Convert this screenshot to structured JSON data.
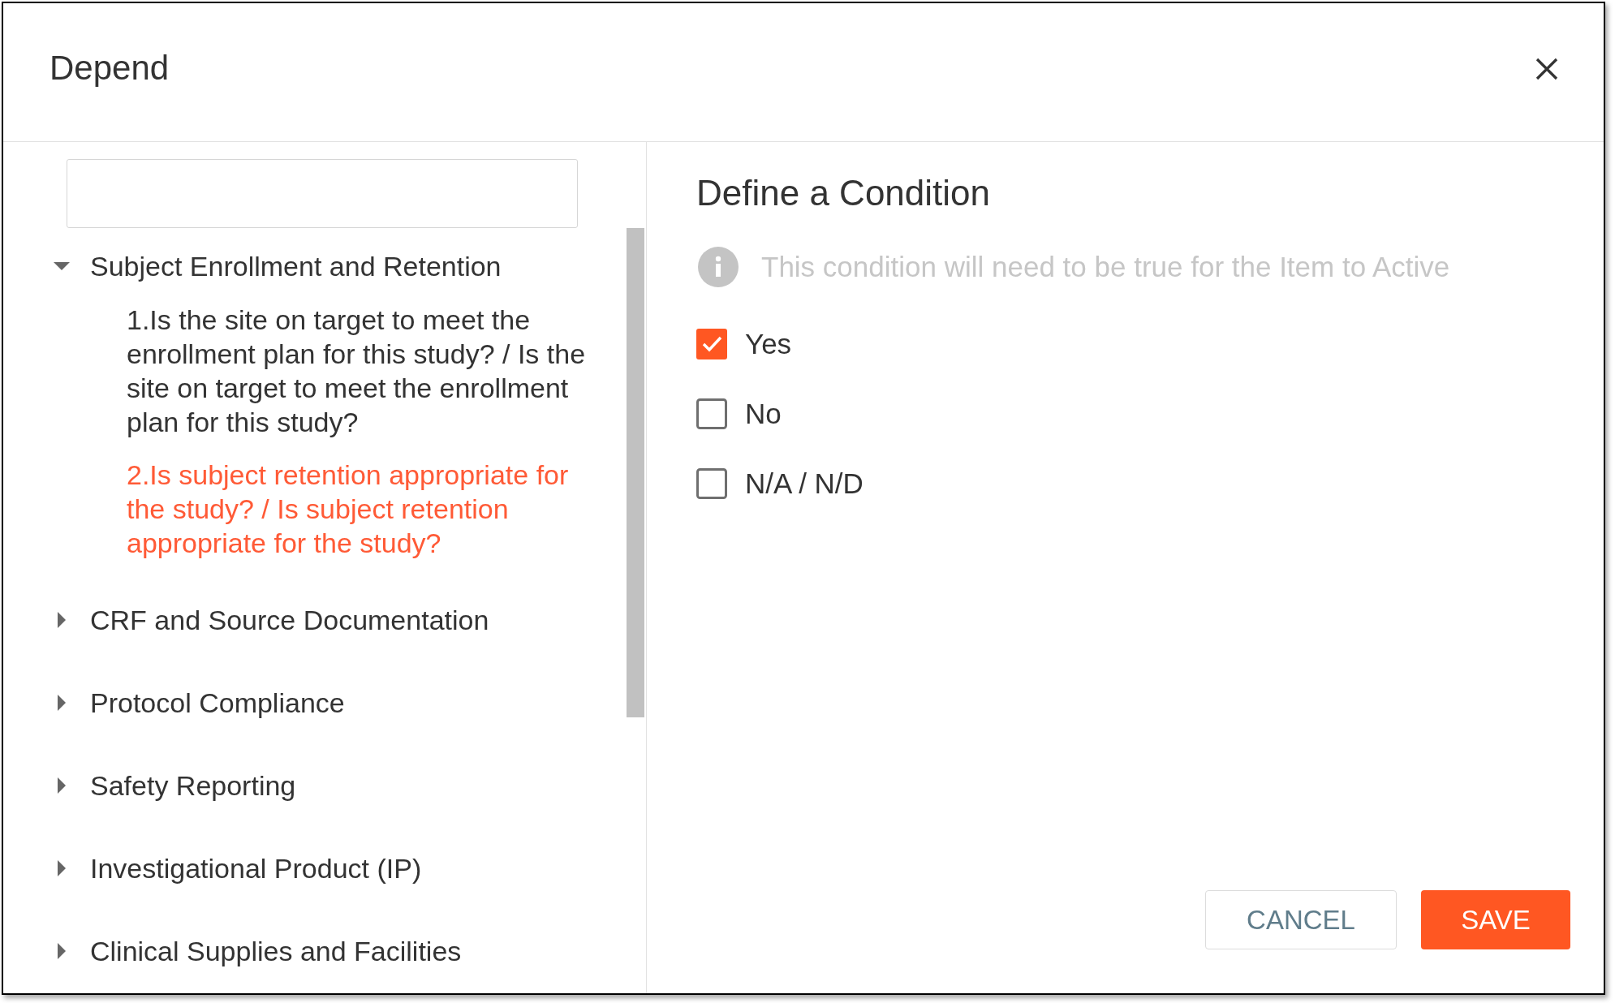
{
  "dialog": {
    "title": "Depend"
  },
  "tree": {
    "items": [
      {
        "label": "Subject Enrollment and Retention",
        "expanded": true,
        "children": [
          {
            "label": "1.Is the site on target to meet the enrollment plan for this study? / Is the site on target to meet the enrollment plan for this study?",
            "selected": false
          },
          {
            "label": "2.Is subject retention appropriate for the study? / Is subject retention appropriate for the study?",
            "selected": true
          }
        ]
      },
      {
        "label": "CRF and Source Documentation",
        "expanded": false
      },
      {
        "label": "Protocol Compliance",
        "expanded": false
      },
      {
        "label": "Safety Reporting",
        "expanded": false
      },
      {
        "label": "Investigational Product (IP)",
        "expanded": false
      },
      {
        "label": "Clinical Supplies and Facilities",
        "expanded": false
      }
    ]
  },
  "condition": {
    "title": "Define a Condition",
    "hint": "This condition will need to be true for the Item to Active",
    "options": [
      {
        "label": "Yes",
        "checked": true
      },
      {
        "label": "No",
        "checked": false
      },
      {
        "label": "N/A / N/D",
        "checked": false
      }
    ]
  },
  "buttons": [
    {
      "label": "CANCEL",
      "kind": "secondary"
    },
    {
      "label": "SAVE",
      "kind": "primary"
    }
  ]
}
